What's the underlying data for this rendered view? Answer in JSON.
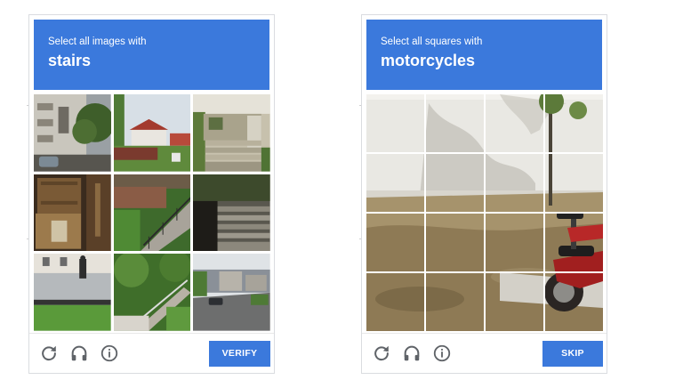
{
  "captchas": [
    {
      "instruction": "Select all images with",
      "keyword": "stairs",
      "action_label": "VERIFY",
      "tiles": [
        "building-with-tree",
        "red-roof-houses",
        "porch-steps",
        "wooden-crates",
        "outdoor-staircase-railing",
        "concrete-steps",
        "person-walking-street",
        "garden-stairs",
        "residential-street-car"
      ]
    },
    {
      "instruction": "Select all squares with",
      "keyword": "motorcycles",
      "action_label": "SKIP",
      "grid": {
        "rows": 4,
        "cols": 4
      }
    }
  ],
  "icons": [
    "reload-icon",
    "headphones-icon",
    "info-icon"
  ],
  "colors": {
    "accent": "#3b79dc",
    "text_on_accent": "#ffffff",
    "icon": "#5f6368"
  }
}
